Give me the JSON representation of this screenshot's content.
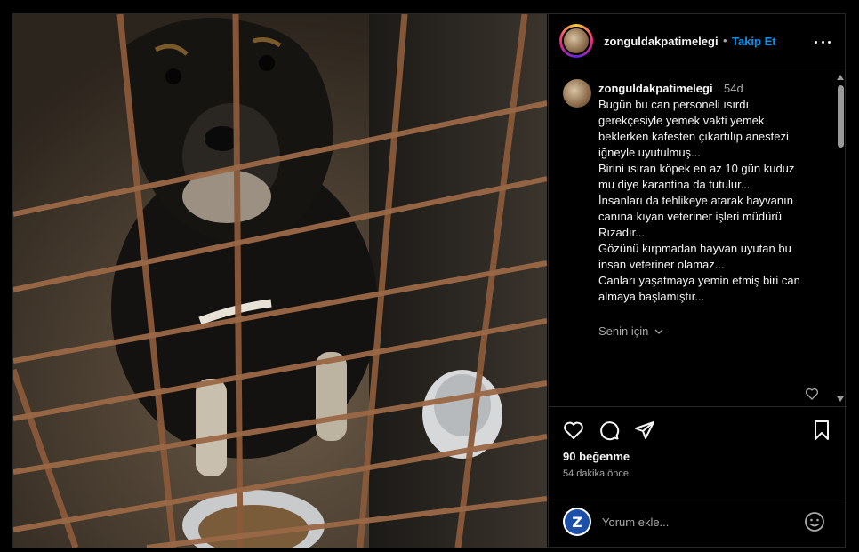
{
  "post": {
    "username": "zonguldakpatimelegi",
    "dot": "•",
    "follow_label": "Takip Et",
    "more_icon": "more-horizontal-icon"
  },
  "caption": {
    "username": "zonguldakpatimelegi",
    "time": "54d",
    "lines": [
      "Bugün bu can personeli ısırdı",
      "gerekçesiyle yemek vakti yemek",
      "beklerken kafesten çıkartılıp anestezi",
      "iğneyle uyutulmuş...",
      "Birini ısıran köpek en az 10 gün kuduz",
      "mu diye karantina da tutulur...",
      "İnsanları da tehlikeye atarak hayvanın",
      "canına kıyan veteriner işleri müdürü",
      "Rızadır...",
      "Gözünü kırpmadan hayvan uyutan bu",
      "insan veteriner olamaz...",
      "Canları yaşatmaya yemin etmiş biri can",
      "almaya başlamıştır..."
    ],
    "senin_icin": "Senin için"
  },
  "actions": {
    "icons": [
      "heart-icon",
      "comment-icon",
      "share-icon",
      "bookmark-icon"
    ]
  },
  "likes": "90 beğenme",
  "time_ago": "54 dakika önce",
  "comment_input": {
    "placeholder": "Yorum ekle...",
    "avatar_letter": "Z"
  },
  "colors": {
    "background": "#000000",
    "border": "#262626",
    "link_blue": "#0095f6",
    "muted_text": "#a8a8a8"
  }
}
